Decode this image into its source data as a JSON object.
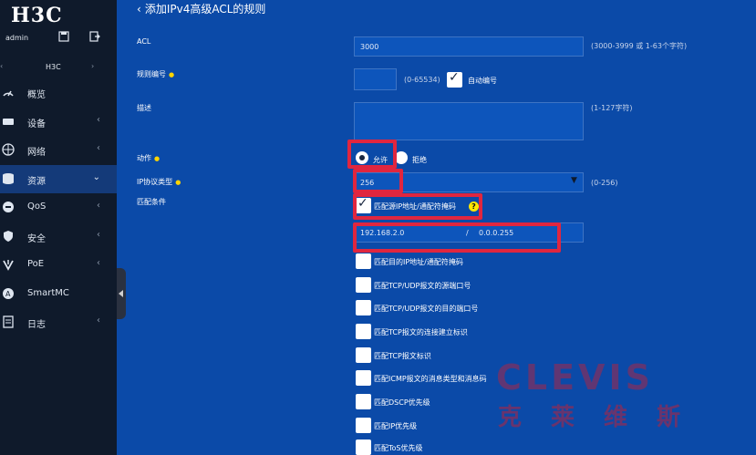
{
  "sidebar": {
    "logo": "H3C",
    "user": "admin",
    "device": "H3C",
    "items": [
      {
        "label": "概览",
        "icon": "gauge-icon",
        "arrow": ""
      },
      {
        "label": "设备",
        "icon": "device-icon",
        "arrow": "‹"
      },
      {
        "label": "网络",
        "icon": "globe-icon",
        "arrow": "‹"
      },
      {
        "label": "资源",
        "icon": "database-icon",
        "arrow": "⌄"
      },
      {
        "label": "QoS",
        "icon": "qos-icon",
        "arrow": "‹"
      },
      {
        "label": "安全",
        "icon": "shield-icon",
        "arrow": "‹"
      },
      {
        "label": "PoE",
        "icon": "poe-icon",
        "arrow": "‹"
      },
      {
        "label": "SmartMC",
        "icon": "smartmc-icon",
        "arrow": ""
      },
      {
        "label": "日志",
        "icon": "log-icon",
        "arrow": "‹"
      }
    ]
  },
  "main": {
    "title": "添加IPv4高级ACL的规则",
    "acl": {
      "label": "ACL",
      "value": "3000",
      "hint": "(3000-3999 或 1-63个字符)"
    },
    "rule_id": {
      "label": "规则编号",
      "value": "",
      "hint": "(0-65534)",
      "auto_label": "自动编号"
    },
    "description": {
      "label": "描述",
      "value": "",
      "hint": "(1-127字符)"
    },
    "action": {
      "label": "动作",
      "permit": "允许",
      "deny": "拒绝"
    },
    "protocol": {
      "label": "IP协议类型",
      "value": "256",
      "hint": "(0-256)"
    },
    "match": {
      "label": "匹配条件",
      "source_ip_label": "匹配源IP地址/通配符掩码",
      "source_ip": "192.168.2.0",
      "separator": "/",
      "wildcard": "0.0.0.255",
      "options": [
        "匹配目的IP地址/通配符掩码",
        "匹配TCP/UDP报文的源端口号",
        "匹配TCP/UDP报文的目的端口号",
        "匹配TCP报文的连接建立标识",
        "匹配TCP报文标识",
        "匹配ICMP报文的消息类型和消息码",
        "匹配DSCP优先级",
        "匹配IP优先级",
        "匹配ToS优先级"
      ]
    }
  },
  "watermark": {
    "latin": "CLEVIS",
    "cn": "克莱维斯"
  },
  "colors": {
    "background": "#0b4aa8",
    "sidebar": "#0f1a2b",
    "highlight": "#e0263f",
    "required": "#ffd400"
  }
}
